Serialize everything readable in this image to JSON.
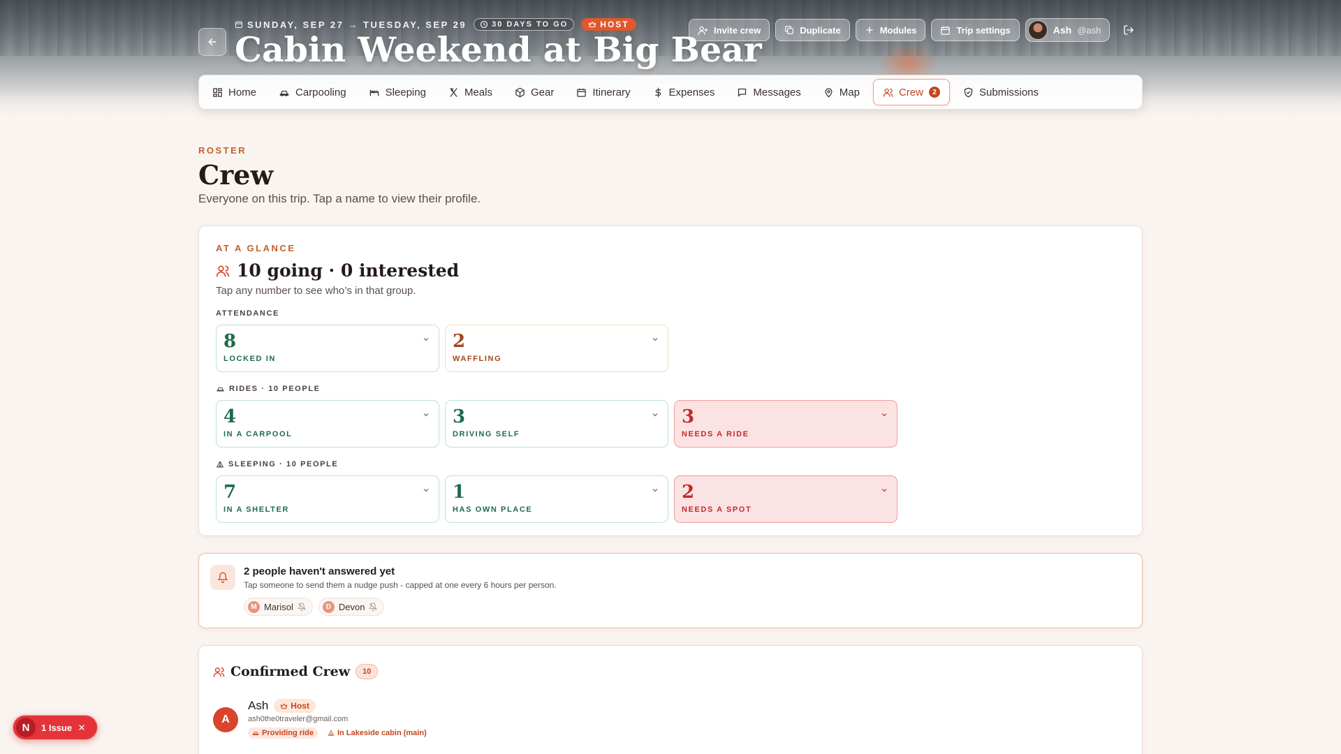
{
  "trip": {
    "dates": "SUNDAY, SEP 27 → TUESDAY, SEP 29",
    "countdown": "30 DAYS TO GO",
    "role": "HOST",
    "title": "Cabin Weekend at Big Bear"
  },
  "actions": {
    "invite": "Invite crew",
    "duplicate": "Duplicate",
    "modules": "Modules",
    "settings": "Trip settings"
  },
  "user": {
    "name": "Ash",
    "handle": "@ash"
  },
  "tabs": [
    {
      "label": "Home",
      "icon": "home-icon"
    },
    {
      "label": "Carpooling",
      "icon": "car-icon"
    },
    {
      "label": "Sleeping",
      "icon": "bed-icon"
    },
    {
      "label": "Meals",
      "icon": "utensils-icon"
    },
    {
      "label": "Gear",
      "icon": "box-icon"
    },
    {
      "label": "Itinerary",
      "icon": "calendar-icon"
    },
    {
      "label": "Expenses",
      "icon": "dollar-icon"
    },
    {
      "label": "Messages",
      "icon": "message-icon"
    },
    {
      "label": "Map",
      "icon": "map-pin-icon"
    },
    {
      "label": "Crew",
      "icon": "users-icon",
      "count": "2",
      "active": true
    },
    {
      "label": "Submissions",
      "icon": "shield-check-icon"
    }
  ],
  "page": {
    "eyebrow": "ROSTER",
    "title": "Crew",
    "subtitle": "Everyone on this trip. Tap a name to view their profile."
  },
  "glance": {
    "eyebrow": "AT A GLANCE",
    "title": "10 going · 0 interested",
    "subtitle": "Tap any number to see who’s in that group.",
    "attendance_label": "ATTENDANCE",
    "attendance": [
      {
        "value": "8",
        "label": "LOCKED IN",
        "tone": "green"
      },
      {
        "value": "2",
        "label": "WAFFLING",
        "tone": "amber"
      }
    ],
    "rides_label": "RIDES · 10 PEOPLE",
    "rides": [
      {
        "value": "4",
        "label": "IN A CARPOOL",
        "tone": "green"
      },
      {
        "value": "3",
        "label": "DRIVING SELF",
        "tone": "green"
      },
      {
        "value": "3",
        "label": "NEEDS A RIDE",
        "tone": "red"
      }
    ],
    "sleeping_label": "SLEEPING · 10 PEOPLE",
    "sleeping": [
      {
        "value": "7",
        "label": "IN A SHELTER",
        "tone": "green"
      },
      {
        "value": "1",
        "label": "HAS OWN PLACE",
        "tone": "green"
      },
      {
        "value": "2",
        "label": "NEEDS A SPOT",
        "tone": "red"
      }
    ]
  },
  "nudge": {
    "title": "2 people haven't answered yet",
    "subtitle": "Tap someone to send them a nudge push - capped at one every 6 hours per person.",
    "people": [
      {
        "initial": "M",
        "name": "Marisol"
      },
      {
        "initial": "D",
        "name": "Devon"
      }
    ]
  },
  "crew": {
    "title": "Confirmed Crew",
    "count": "10",
    "members": [
      {
        "initial": "A",
        "name": "Ash",
        "badge": "Host",
        "email": "ash0the0traveler@gmail.com",
        "ride_tag": "Providing ride",
        "sleep_tag": "In Lakeside cabin (main)"
      }
    ]
  },
  "issues": {
    "logo": "N",
    "label": "1 Issue"
  },
  "colors": {
    "accent": "#e2572d",
    "green": "#1f6b4b",
    "red": "#c42a2a",
    "amber": "#a0461d"
  }
}
